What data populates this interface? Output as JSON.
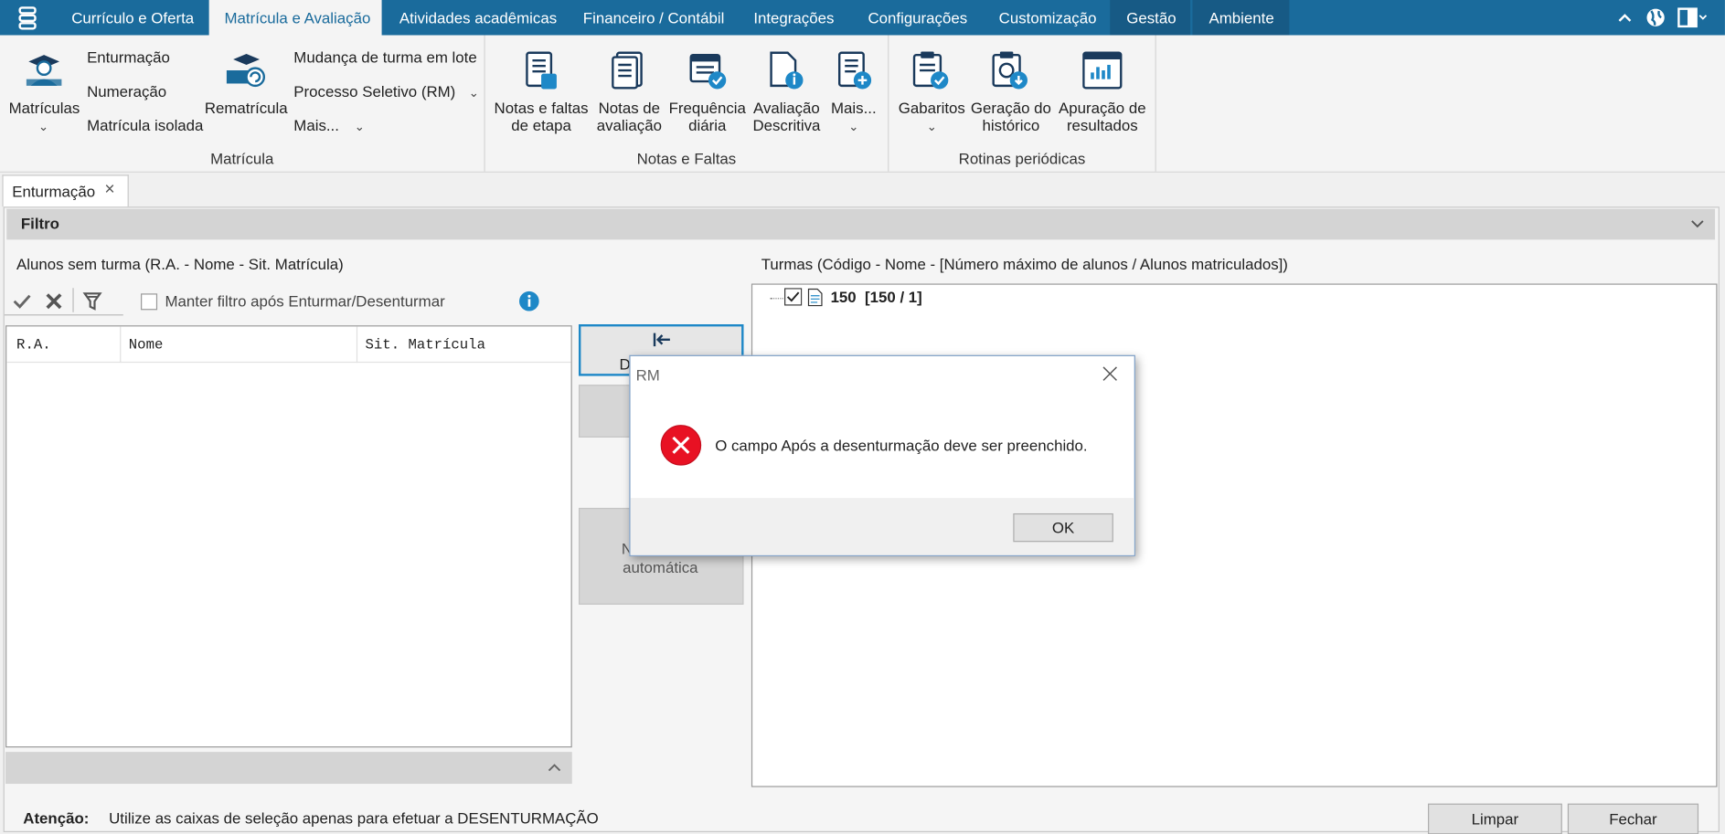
{
  "menu": {
    "tabs": [
      "Currículo e Oferta",
      "Matrícula e Avaliação",
      "Atividades acadêmicas",
      "Financeiro / Contábil",
      "Integrações",
      "Configurações",
      "Customização",
      "Gestão",
      "Ambiente"
    ],
    "app_icon": "app-menu-icon",
    "right_icons": [
      "chevron-up-icon",
      "globe-icon",
      "layout-icon"
    ]
  },
  "ribbon": {
    "matricula": {
      "matriculas": "Matrículas",
      "enturmacao": "Enturmação",
      "numeracao": "Numeração",
      "matricula_isolada": "Matrícula isolada",
      "rematricula": "Rematrícula",
      "mudanca": "Mudança de turma em lote",
      "processo": "Processo Seletivo (RM)",
      "mais": "Mais...",
      "title": "Matrícula"
    },
    "notas": {
      "notas_faltas_1": "Notas e faltas",
      "notas_faltas_2": "de etapa",
      "notas_aval_1": "Notas de",
      "notas_aval_2": "avaliação",
      "freq_1": "Frequência",
      "freq_2": "diária",
      "aval_1": "Avaliação",
      "aval_2": "Descritiva",
      "mais": "Mais...",
      "title": "Notas e Faltas"
    },
    "rotinas": {
      "gabaritos": "Gabaritos",
      "geracao_1": "Geração do",
      "geracao_2": "histórico",
      "apuracao_1": "Apuração de",
      "apuracao_2": "resultados",
      "title": "Rotinas periódicas"
    }
  },
  "doc_tab": {
    "label": "Enturmação",
    "close": "×"
  },
  "filter": {
    "label": "Filtro"
  },
  "left": {
    "title": "Alunos sem turma (R.A. - Nome - Sit. Matrícula)",
    "keep_filter": "Manter filtro após Enturmar/Desenturmar",
    "columns": [
      "R.A.",
      "Nome",
      "Sit. Matrícula"
    ]
  },
  "middle": {
    "desenturmar_partial": "D",
    "auto_partial_1": "N",
    "auto_partial_2": "automática"
  },
  "right": {
    "title": "Turmas (Código - Nome - [Número máximo de alunos / Alunos matriculados])",
    "tree_item": "150  [150 / 1]"
  },
  "footer": {
    "attention_label": "Atenção:",
    "attention_text": "Utilize as caixas de seleção apenas para efetuar a DESENTURMAÇÃO",
    "limpar": "Limpar",
    "fechar": "Fechar"
  },
  "dialog": {
    "title": "RM",
    "message": "O campo Após a desenturmação deve ser preenchido.",
    "ok": "OK",
    "error_color": "#e81123"
  },
  "colors": {
    "brand": "#1a6b9c",
    "icon": "#1a6b9c",
    "accent": "#1e88c7"
  }
}
